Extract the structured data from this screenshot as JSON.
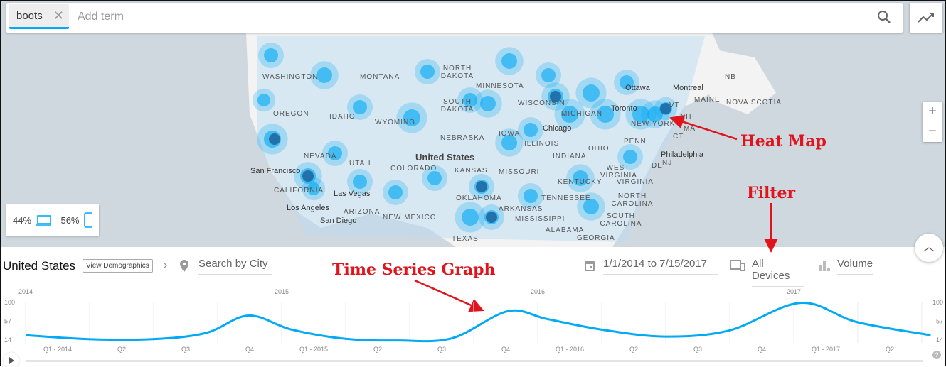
{
  "search": {
    "term": "boots",
    "placeholder": "Add term"
  },
  "map": {
    "country_label": "United States",
    "states": [
      "WASHINGTON",
      "MONTANA",
      "NORTH DAKOTA",
      "MINNESOTA",
      "OREGON",
      "IDAHO",
      "SOUTH DAKOTA",
      "WISCONSIN",
      "WYOMING",
      "MICHIGAN",
      "NEBRASKA",
      "IOWA",
      "NEVADA",
      "UTAH",
      "ILLINOIS",
      "INDIANA",
      "OHIO",
      "COLORADO",
      "KANSAS",
      "MISSOURI",
      "CALIFORNIA",
      "KENTUCKY",
      "WEST VIRGINIA",
      "VIRGINIA",
      "ARIZONA",
      "NEW MEXICO",
      "OKLAHOMA",
      "TENNESSEE",
      "NORTH CAROLINA",
      "ARKANSAS",
      "SOUTH CAROLINA",
      "MISSISSIPPI",
      "ALABAMA",
      "GEORGIA",
      "TEXAS",
      "NEW YORK",
      "PENN",
      "MAINE",
      "NB",
      "NOVA SCOTIA",
      "NH",
      "VT",
      "MA",
      "CT",
      "NJ",
      "DE"
    ],
    "cities": [
      "San Francisco",
      "Las Vegas",
      "Los Angeles",
      "San Diego",
      "Chicago",
      "Toronto",
      "Ottawa",
      "Montreal",
      "Philadelphia"
    ],
    "heat_color": "#03a9f4"
  },
  "device_share": {
    "desktop": "44%",
    "mobile": "56%"
  },
  "annotations": {
    "heat_map": "Heat Map",
    "filter": "Filter",
    "time_series": "Time Series Graph"
  },
  "toolbar": {
    "region": "United States",
    "view_demographics": "View Demographics",
    "city_placeholder": "Search by City",
    "date_from": "1/1/2014",
    "date_to_word": "to",
    "date_to": "7/15/2017",
    "devices": "All Devices",
    "metric": "Volume"
  },
  "chart_data": {
    "type": "line",
    "color": "#03a9f4",
    "year_labels": [
      "2014",
      "2015",
      "2016",
      "2017"
    ],
    "quarter_labels": [
      "Q1 - 2014",
      "Q2",
      "Q3",
      "Q4",
      "Q1 - 2015",
      "Q2",
      "Q3",
      "Q4",
      "Q1 - 2016",
      "Q2",
      "Q3",
      "Q4",
      "Q1 - 2017",
      "Q2"
    ],
    "y_ticks": [
      100,
      57,
      14
    ],
    "ylim": [
      14,
      100
    ],
    "x": [
      "2014-01-01",
      "2014-04-01",
      "2014-07-01",
      "2014-09-15",
      "2014-11-15",
      "2015-01-15",
      "2015-04-01",
      "2015-06-15",
      "2015-09-01",
      "2015-11-20",
      "2016-01-15",
      "2016-04-01",
      "2016-07-01",
      "2016-10-01",
      "2017-01-10",
      "2017-04-01",
      "2017-07-15"
    ],
    "values": [
      25,
      16,
      16,
      30,
      70,
      38,
      17,
      13,
      18,
      80,
      62,
      38,
      22,
      36,
      99,
      55,
      25
    ]
  }
}
